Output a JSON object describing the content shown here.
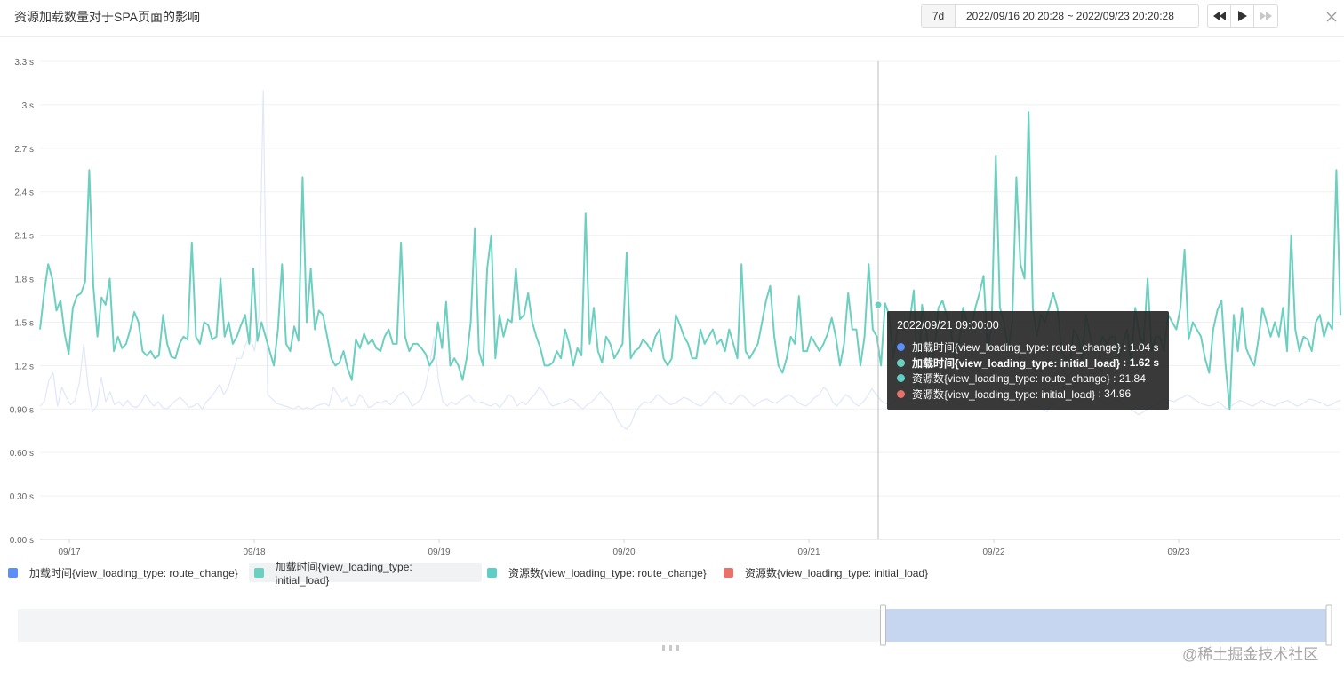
{
  "header": {
    "title": "资源加载数量对于SPA页面的影响",
    "range_button": "7d",
    "range_text": "2022/09/16 20:20:28 ~ 2022/09/23 20:20:28"
  },
  "controls": {
    "rewind_icon": "rewind-icon",
    "play_icon": "play-icon",
    "forward_icon": "fast-forward-icon",
    "close_icon": "close-icon"
  },
  "colors": {
    "route_change_time": "#5b8ff9",
    "initial_load_time": "#6cd0c0",
    "resources_route_change": "#5ad8a6",
    "resources_initial_load": "#e8726a"
  },
  "chart_data": {
    "type": "line",
    "y_tick_labels": [
      "0.00 s",
      "0.30 s",
      "0.60 s",
      "0.90 s",
      "1.2 s",
      "1.5 s",
      "1.8 s",
      "2.1 s",
      "2.4 s",
      "2.7 s",
      "3 s",
      "3.3 s"
    ],
    "ylim": [
      0,
      3.3
    ],
    "x_tick_labels": [
      "09/17",
      "09/18",
      "09/19",
      "09/20",
      "09/21",
      "09/22",
      "09/23"
    ],
    "xlim": [
      "2022/09/16 20:20",
      "2022/09/23 20:20"
    ],
    "grid": true,
    "legend_position": "bottom-left",
    "series": [
      {
        "name": "加载时间{view_loading_type: route_change}",
        "color": "#5b8ff9",
        "values": [
          0.92,
          0.95,
          1.1,
          1.15,
          0.92,
          1.05,
          0.98,
          0.93,
          0.96,
          1.08,
          1.35,
          1.05,
          0.88,
          0.92,
          1.12,
          0.95,
          1.02,
          0.93,
          0.95,
          0.92,
          0.96,
          0.92,
          0.91,
          0.94,
          1.0,
          0.96,
          0.92,
          0.95,
          0.91,
          0.9,
          0.93,
          0.96,
          0.98,
          0.95,
          0.91,
          0.92,
          0.94,
          0.9,
          0.95,
          0.98,
          1.02,
          1.07,
          1.0,
          1.05,
          1.15,
          1.25,
          1.25,
          1.35,
          1.4,
          1.3,
          1.55,
          3.1,
          1.0,
          0.97,
          0.94,
          0.93,
          0.92,
          0.91,
          0.9,
          0.92,
          0.9,
          0.91,
          0.9,
          0.92,
          0.93,
          0.94,
          0.92,
          1.05,
          1.0,
          0.95,
          0.98,
          0.92,
          0.93,
          1.0,
          0.97,
          0.91,
          0.92,
          0.95,
          0.94,
          0.96,
          0.93,
          0.96,
          1.0,
          1.02,
          0.98,
          0.92,
          0.94,
          0.97,
          1.05,
          1.2,
          1.4,
          1.1,
          0.95,
          0.92,
          0.95,
          0.93,
          0.96,
          0.98,
          1.0,
          0.96,
          0.94,
          0.95,
          0.93,
          0.92,
          0.94,
          0.91,
          0.95,
          1.0,
          0.98,
          0.92,
          0.95,
          0.93,
          0.97,
          1.0,
          1.05,
          1.02,
          0.96,
          0.92,
          0.93,
          0.94,
          0.95,
          0.97,
          0.96,
          0.92,
          0.9,
          0.93,
          0.95,
          0.98,
          1.02,
          0.98,
          0.95,
          0.9,
          0.82,
          0.78,
          0.76,
          0.8,
          0.88,
          0.92,
          0.95,
          0.94,
          0.96,
          1.0,
          0.98,
          0.95,
          0.93,
          0.94,
          0.96,
          0.98,
          0.97,
          0.95,
          0.93,
          0.92,
          0.95,
          0.98,
          1.02,
          1.0,
          0.96,
          0.94,
          0.93,
          0.97,
          1.0,
          0.98,
          0.95,
          0.92,
          0.94,
          0.96,
          0.97,
          0.95,
          0.94,
          0.96,
          0.98,
          1.0,
          0.98,
          0.95,
          0.93,
          0.92,
          0.95,
          0.98,
          1.0,
          1.05,
          1.02,
          0.95,
          0.92,
          0.96,
          1.0,
          0.98,
          0.94,
          0.92,
          0.95,
          0.99,
          1.04,
          1.0,
          0.96,
          0.94,
          0.93,
          0.95,
          0.98,
          1.0,
          0.96,
          0.95,
          0.98,
          1.02,
          1.0,
          0.96,
          0.94,
          0.95,
          0.98,
          1.0,
          0.97,
          0.95,
          0.93,
          0.94,
          0.96,
          0.98,
          0.95,
          0.94,
          0.96,
          0.98,
          1.0,
          0.97,
          0.95,
          0.93,
          0.92,
          0.95,
          0.97,
          0.95,
          0.93,
          0.91,
          0.92,
          0.9,
          0.88,
          0.95,
          0.92,
          0.9,
          0.92,
          0.95,
          0.98,
          0.96,
          0.95,
          0.97,
          1.0,
          0.98,
          0.96,
          0.94,
          0.93,
          0.95,
          0.96,
          0.94,
          0.92,
          0.9,
          0.88,
          0.86,
          0.88,
          0.9,
          0.92,
          0.93,
          0.95,
          0.97,
          0.96,
          0.95,
          0.97,
          0.98,
          1.0,
          0.98,
          0.96,
          0.94,
          0.93,
          0.92,
          0.93,
          0.95,
          0.93,
          0.9,
          0.92,
          0.94,
          0.96,
          0.95,
          0.93,
          0.92,
          0.94,
          0.96,
          0.94,
          0.93,
          0.92,
          0.94,
          0.95,
          0.96,
          0.94,
          0.92,
          0.93,
          0.95,
          0.97,
          0.96,
          0.95,
          0.94,
          0.92,
          0.93,
          0.95,
          0.96
        ]
      },
      {
        "name": "加载时间{view_loading_type: initial_load}",
        "color": "#6cd0c0",
        "values": [
          1.45,
          1.7,
          1.9,
          1.8,
          1.58,
          1.65,
          1.42,
          1.28,
          1.6,
          1.68,
          1.7,
          1.78,
          2.55,
          1.75,
          1.4,
          1.67,
          1.62,
          1.8,
          1.3,
          1.4,
          1.32,
          1.35,
          1.45,
          1.57,
          1.5,
          1.3,
          1.27,
          1.3,
          1.25,
          1.27,
          1.55,
          1.35,
          1.26,
          1.25,
          1.35,
          1.4,
          1.38,
          2.05,
          1.4,
          1.35,
          1.5,
          1.48,
          1.38,
          1.4,
          1.8,
          1.4,
          1.5,
          1.35,
          1.4,
          1.48,
          1.55,
          1.35,
          1.87,
          1.37,
          1.5,
          1.4,
          1.3,
          1.2,
          1.45,
          1.9,
          1.35,
          1.3,
          1.47,
          1.37,
          2.5,
          1.5,
          1.87,
          1.45,
          1.58,
          1.55,
          1.4,
          1.25,
          1.2,
          1.22,
          1.3,
          1.18,
          1.1,
          1.38,
          1.32,
          1.42,
          1.35,
          1.38,
          1.32,
          1.3,
          1.4,
          1.45,
          1.35,
          1.35,
          2.05,
          1.4,
          1.3,
          1.35,
          1.35,
          1.32,
          1.28,
          1.2,
          1.25,
          1.5,
          1.32,
          1.64,
          1.2,
          1.25,
          1.2,
          1.1,
          1.25,
          1.5,
          2.15,
          1.3,
          1.2,
          1.87,
          2.1,
          1.25,
          1.55,
          1.4,
          1.52,
          1.5,
          1.87,
          1.52,
          1.55,
          1.7,
          1.5,
          1.4,
          1.32,
          1.2,
          1.2,
          1.22,
          1.3,
          1.25,
          1.45,
          1.35,
          1.2,
          1.32,
          1.27,
          2.25,
          1.35,
          1.6,
          1.3,
          1.22,
          1.4,
          1.35,
          1.25,
          1.3,
          1.35,
          1.98,
          1.25,
          1.3,
          1.32,
          1.38,
          1.35,
          1.3,
          1.4,
          1.45,
          1.25,
          1.2,
          1.25,
          1.55,
          1.48,
          1.4,
          1.35,
          1.25,
          1.25,
          1.45,
          1.35,
          1.4,
          1.45,
          1.35,
          1.38,
          1.3,
          1.45,
          1.35,
          1.25,
          1.9,
          1.3,
          1.25,
          1.3,
          1.35,
          1.5,
          1.65,
          1.75,
          1.4,
          1.2,
          1.15,
          1.25,
          1.4,
          1.35,
          1.68,
          1.3,
          1.3,
          1.4,
          1.35,
          1.3,
          1.35,
          1.42,
          1.53,
          1.4,
          1.2,
          1.35,
          1.7,
          1.45,
          1.45,
          1.2,
          1.4,
          1.9,
          1.45,
          1.4,
          1.2,
          1.63,
          1.55,
          1.25,
          1.45,
          1.45,
          1.45,
          1.5,
          1.72,
          1.05,
          1.62,
          1.45,
          1.2,
          1.3,
          1.6,
          1.65,
          1.55,
          1.45,
          1.25,
          1.35,
          1.6,
          1.5,
          1.45,
          1.6,
          1.7,
          1.82,
          1.3,
          1.5,
          2.65,
          1.6,
          1.5,
          1.3,
          1.5,
          2.5,
          1.9,
          1.8,
          2.95,
          1.6,
          1.4,
          1.55,
          1.5,
          1.6,
          1.7,
          1.6,
          1.3,
          1.25,
          1.2,
          1.45,
          1.4,
          1.25,
          1.55,
          1.4,
          1.3,
          1.3,
          1.4,
          1.35,
          1.4,
          1.4,
          1.25,
          1.35,
          1.45,
          1.2,
          1.6,
          1.4,
          1.35,
          1.8,
          1.3,
          1.4,
          1.4,
          1.3,
          1.55,
          1.5,
          1.45,
          1.6,
          2.0,
          1.38,
          1.5,
          1.45,
          1.4,
          1.25,
          1.15,
          1.45,
          1.58,
          1.65,
          1.2,
          0.9,
          1.55,
          1.3,
          1.6,
          1.32,
          1.25,
          1.2,
          1.38,
          1.6,
          1.5,
          1.4,
          1.5,
          1.4,
          1.6,
          1.3,
          2.1,
          1.45,
          1.3,
          1.4,
          1.38,
          1.3,
          1.5,
          1.55,
          1.4,
          1.5,
          1.45,
          2.55,
          1.55
        ]
      }
    ]
  },
  "legend": [
    {
      "label": "加载时间{view_loading_type: route_change}",
      "color": "#5b8ff9"
    },
    {
      "label": "加载时间{view_loading_type: initial_load}",
      "color": "#6cd0c0"
    },
    {
      "label": "资源数{view_loading_type: route_change}",
      "color": "#5ad8a6"
    },
    {
      "label": "资源数{view_loading_type: initial_load}",
      "color": "#e8726a"
    }
  ],
  "tooltip": {
    "time": "2022/09/21 09:00:00",
    "rows": [
      {
        "label": "加载时间{view_loading_type: route_change}",
        "value": "1.04 s",
        "color": "#5b8ff9"
      },
      {
        "label": "加载时间{view_loading_type: initial_load}",
        "value": "1.62 s",
        "color": "#6cd0c0"
      },
      {
        "label": "资源数{view_loading_type: route_change}",
        "value": "21.84",
        "color": "#5ad8a6"
      },
      {
        "label": "资源数{view_loading_type: initial_load}",
        "value": "34.96",
        "color": "#e8726a"
      }
    ]
  },
  "slider": {
    "start_fraction": 0.66,
    "end_fraction": 1.0
  },
  "watermark": "@稀土掘金技术社区"
}
